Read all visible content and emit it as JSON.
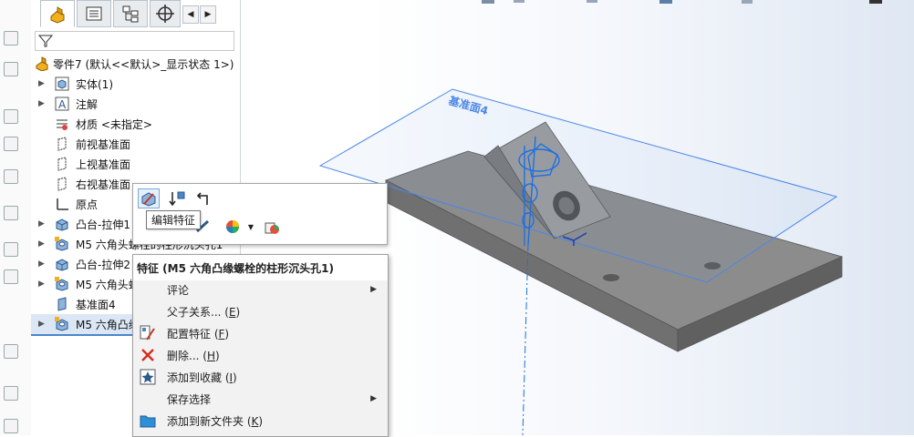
{
  "tree": {
    "root_label": "零件7 (默认<<默认>_显示状态 1>)",
    "items": [
      {
        "label": "实体(1)",
        "icon": "solid-bodies-icon",
        "expandable": true
      },
      {
        "label": "注解",
        "icon": "annotations-icon",
        "expandable": true
      },
      {
        "label": "材质 <未指定>",
        "icon": "material-icon",
        "expandable": false
      },
      {
        "label": "前视基准面",
        "icon": "plane-icon",
        "expandable": false
      },
      {
        "label": "上视基准面",
        "icon": "plane-icon",
        "expandable": false
      },
      {
        "label": "右视基准面",
        "icon": "plane-icon",
        "expandable": false
      },
      {
        "label": "原点",
        "icon": "origin-icon",
        "expandable": false
      },
      {
        "label": "凸台-拉伸1",
        "icon": "extrude-icon",
        "expandable": true
      },
      {
        "label": "M5 六角头螺栓的柱形沉头孔1",
        "icon": "hole-wizard-icon",
        "expandable": true
      },
      {
        "label": "凸台-拉伸2",
        "icon": "extrude-icon",
        "expandable": true
      },
      {
        "label": "M5 六角头螺",
        "icon": "hole-wizard-icon",
        "expandable": true
      },
      {
        "label": "基准面4",
        "icon": "plane-icon",
        "expandable": false
      },
      {
        "label": "M5 六角凸缘",
        "icon": "hole-wizard-icon",
        "expandable": true
      }
    ]
  },
  "context_toolbar": {
    "tooltip": "编辑特征"
  },
  "context_menu": {
    "header": "特征 (M5 六角凸缘螺栓的柱形沉头孔1)",
    "items": [
      {
        "label": "评论",
        "key": "",
        "submenu": true,
        "icon": ""
      },
      {
        "label": "父子关系... (",
        "key": "E",
        "suffix": ")",
        "submenu": false,
        "icon": ""
      },
      {
        "label": "配置特征 (",
        "key": "F",
        "suffix": ")",
        "submenu": false,
        "icon": "configure-feature-icon"
      },
      {
        "label": "删除... (",
        "key": "H",
        "suffix": ")",
        "submenu": false,
        "icon": "delete-icon"
      },
      {
        "label": "添加到收藏 (",
        "key": "I",
        "suffix": ")",
        "submenu": false,
        "icon": "favorite-icon"
      },
      {
        "label": "保存选择",
        "key": "",
        "submenu": true,
        "icon": ""
      },
      {
        "label": "添加到新文件夹 (",
        "key": "K",
        "suffix": ")",
        "submenu": false,
        "icon": "folder-icon"
      }
    ]
  },
  "viewport": {
    "plane_label": "基准面4",
    "colors": {
      "plane": "#4a86e8",
      "part_top": "#8a8a8a",
      "part_side": "#6e6e6e",
      "sketch": "#1e6fe0"
    }
  }
}
